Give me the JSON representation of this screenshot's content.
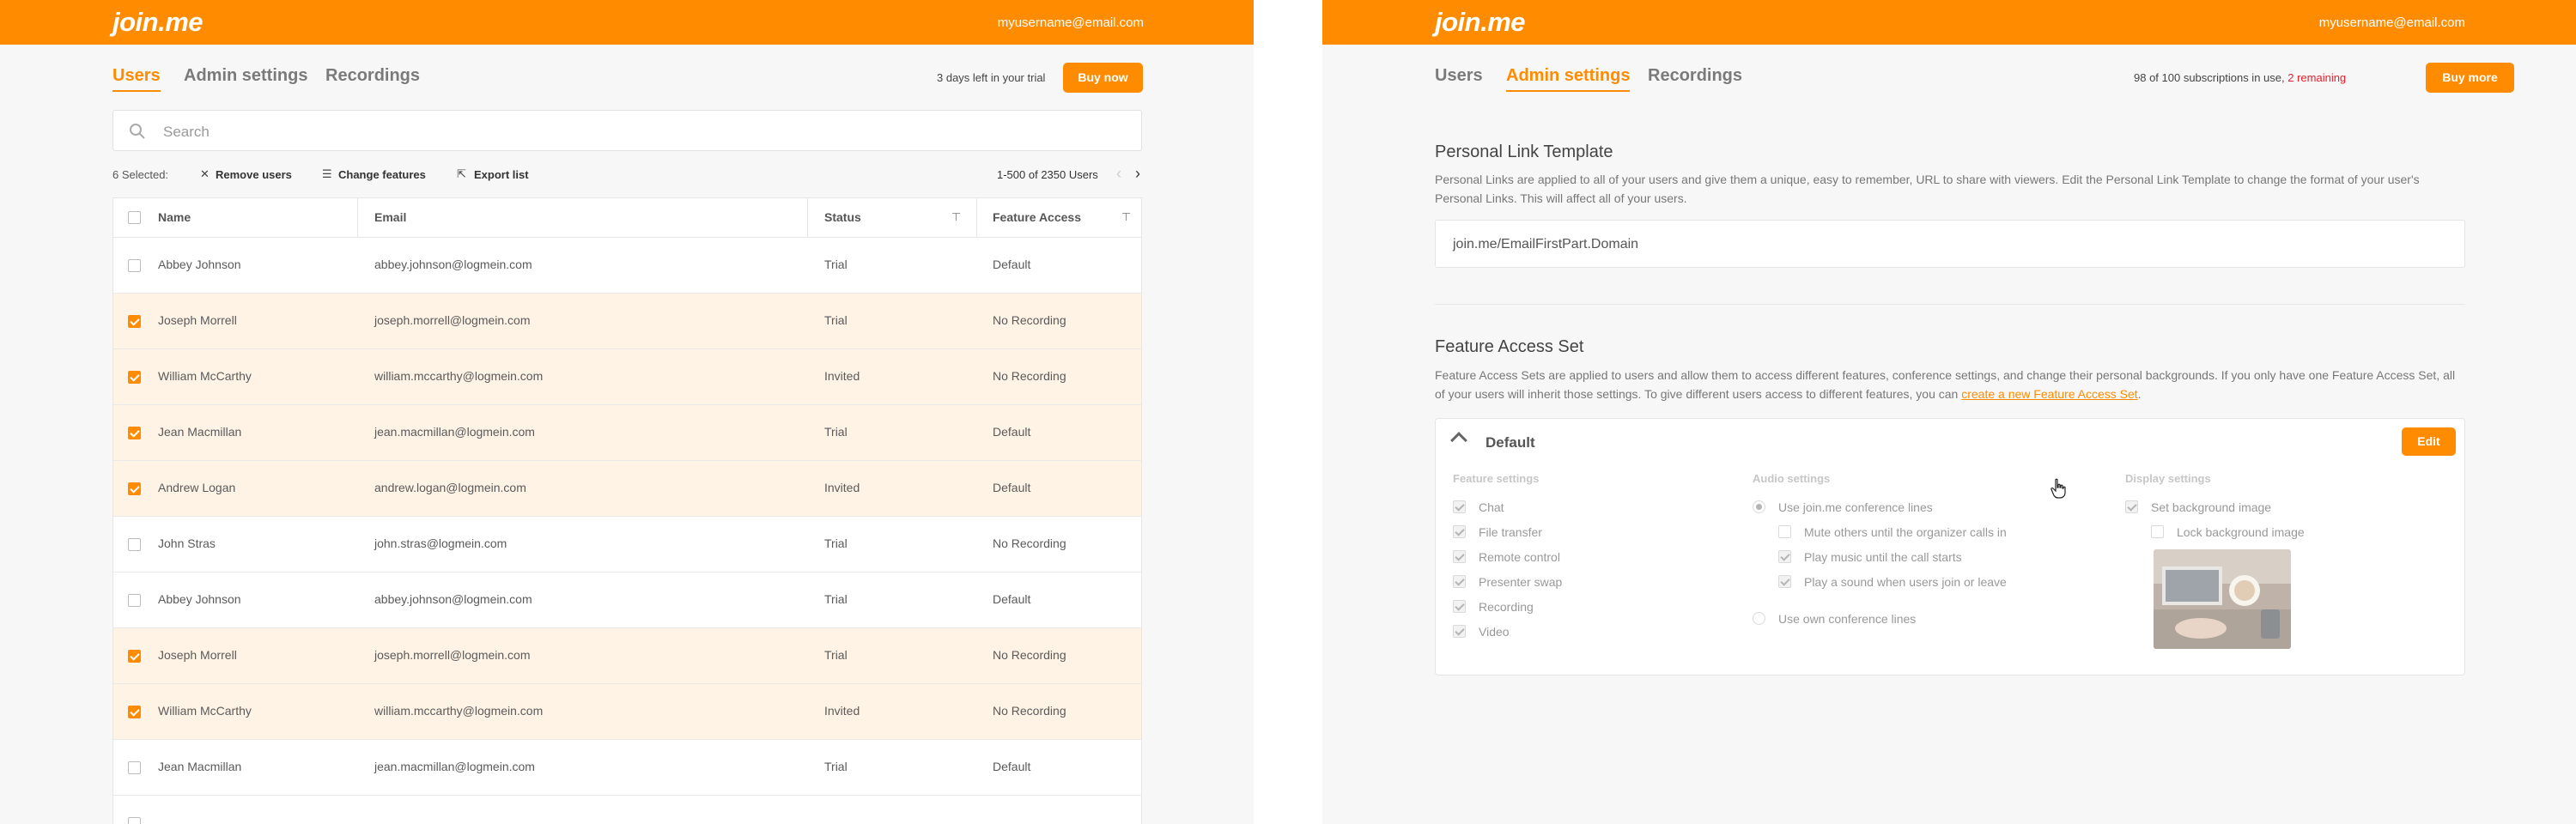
{
  "left": {
    "logo": "join.me",
    "user_email": "myusername@email.com",
    "tabs": [
      {
        "label": "Users",
        "active": true
      },
      {
        "label": "Admin settings",
        "active": false
      },
      {
        "label": "Recordings",
        "active": false
      }
    ],
    "trial_note": "3 days left in your trial",
    "buy_now": "Buy now",
    "search_placeholder": "Search",
    "selected_count": "6 Selected:",
    "actions": {
      "remove": "Remove users",
      "change": "Change features",
      "export": "Export list"
    },
    "pager": "1-500 of 2350 Users",
    "columns": [
      "Name",
      "Email",
      "Status",
      "Feature Access"
    ],
    "rows": [
      {
        "name": "Abbey Johnson",
        "email": "abbey.johnson@logmein.com",
        "status": "Trial",
        "access": "Default",
        "selected": false
      },
      {
        "name": "Joseph Morrell",
        "email": "joseph.morrell@logmein.com",
        "status": "Trial",
        "access": "No Recording",
        "selected": true
      },
      {
        "name": "William McCarthy",
        "email": "william.mccarthy@logmein.com",
        "status": "Invited",
        "access": "No Recording",
        "selected": true
      },
      {
        "name": "Jean Macmillan",
        "email": "jean.macmillan@logmein.com",
        "status": "Trial",
        "access": "Default",
        "selected": true
      },
      {
        "name": "Andrew Logan",
        "email": "andrew.logan@logmein.com",
        "status": "Invited",
        "access": "Default",
        "selected": true
      },
      {
        "name": "John Stras",
        "email": "john.stras@logmein.com",
        "status": "Trial",
        "access": "No Recording",
        "selected": false
      },
      {
        "name": "Abbey Johnson",
        "email": "abbey.johnson@logmein.com",
        "status": "Trial",
        "access": "Default",
        "selected": false
      },
      {
        "name": "Joseph Morrell",
        "email": "joseph.morrell@logmein.com",
        "status": "Trial",
        "access": "No Recording",
        "selected": true
      },
      {
        "name": "William McCarthy",
        "email": "william.mccarthy@logmein.com",
        "status": "Invited",
        "access": "No Recording",
        "selected": true
      },
      {
        "name": "Jean Macmillan",
        "email": "jean.macmillan@logmein.com",
        "status": "Trial",
        "access": "Default",
        "selected": false
      }
    ]
  },
  "right": {
    "logo": "join.me",
    "user_email": "myusername@email.com",
    "tabs": [
      {
        "label": "Users",
        "active": false
      },
      {
        "label": "Admin settings",
        "active": true
      },
      {
        "label": "Recordings",
        "active": false
      }
    ],
    "subscriptions": "98 of 100 subscriptions in use,",
    "remaining": "2 remaining",
    "buy_more": "Buy more",
    "personal_link": {
      "title": "Personal Link Template",
      "description": "Personal Links are applied to all of your users and give them a unique, easy to remember, URL to share with viewers. Edit the Personal Link Template to change the format of your user's Personal Links. This will affect all of your users.",
      "template": "join.me/EmailFirstPart.Domain"
    },
    "feature_access": {
      "title": "Feature Access Set",
      "description": "Feature Access Sets are applied to users and allow them to access different features, conference settings, and change their personal backgrounds. If you only have one Feature Access Set, all of your users will inherit those settings. To give different users access to different features, you can",
      "link": "create a new Feature Access Set",
      "after_link": ".",
      "set_name": "Default",
      "edit": "Edit",
      "feature_settings": {
        "heading": "Feature settings",
        "items": [
          "Chat",
          "File transfer",
          "Remote control",
          "Presenter swap",
          "Recording",
          "Video"
        ]
      },
      "audio_settings": {
        "heading": "Audio settings",
        "use_joinme": "Use join.me conference lines",
        "mute": "Mute others until the organizer calls in",
        "music": "Play music until the call starts",
        "sound": "Play a sound when users join or leave",
        "use_own": "Use own conference lines"
      },
      "display_settings": {
        "heading": "Display settings",
        "set_bg": "Set background image",
        "lock_bg": "Lock background image"
      }
    }
  },
  "colors": {
    "accent": "#ff8c00",
    "remaining": "#e8202a",
    "selected_row": "#fff3e6"
  }
}
